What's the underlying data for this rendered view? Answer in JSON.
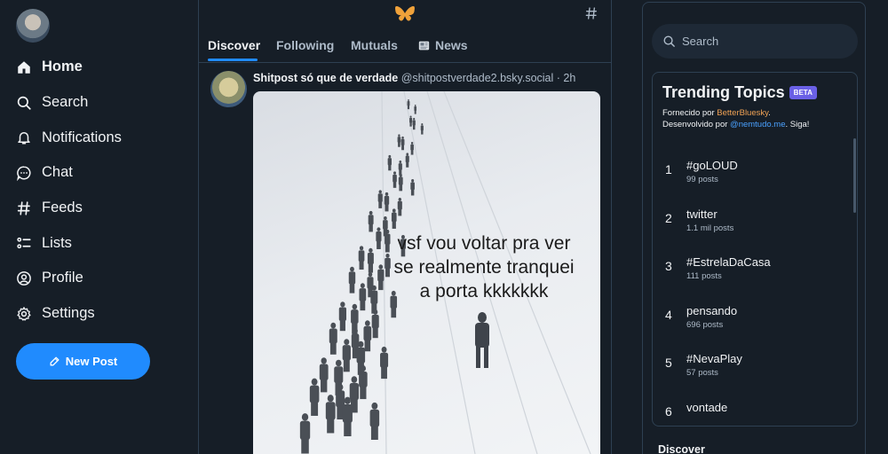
{
  "nav": {
    "items": [
      {
        "id": "home",
        "label": "Home"
      },
      {
        "id": "search",
        "label": "Search"
      },
      {
        "id": "notifications",
        "label": "Notifications"
      },
      {
        "id": "chat",
        "label": "Chat"
      },
      {
        "id": "feeds",
        "label": "Feeds"
      },
      {
        "id": "lists",
        "label": "Lists"
      },
      {
        "id": "profile",
        "label": "Profile"
      },
      {
        "id": "settings",
        "label": "Settings"
      }
    ],
    "active": "home",
    "new_post_label": "New Post"
  },
  "feed": {
    "tabs": [
      "Discover",
      "Following",
      "Mutuals",
      "News"
    ],
    "active_tab": "Discover",
    "post": {
      "author": "Shitpost só que de verdade",
      "handle": "@shitpostverdade2.bsky.social",
      "time": "· 2h",
      "image_text": [
        "vsf vou voltar pra ver",
        "se realmente tranquei",
        "a porta kkkkkkk"
      ]
    }
  },
  "sidebar": {
    "search_placeholder": "Search",
    "trending": {
      "title": "Trending Topics",
      "badge": "BETA",
      "provided_by_prefix": "Fornecido por ",
      "provided_by": "BetterBluesky",
      "provided_by_suffix": ".",
      "developed_by_prefix": "Desenvolvido por ",
      "developed_by": "@nemtudo.me",
      "developed_by_suffix": ". Siga!",
      "items": [
        {
          "rank": "1",
          "name": "#goLOUD",
          "count": "99 posts"
        },
        {
          "rank": "2",
          "name": "twitter",
          "count": "1.1 mil posts"
        },
        {
          "rank": "3",
          "name": "#EstrelaDaCasa",
          "count": "111 posts"
        },
        {
          "rank": "4",
          "name": "pensando",
          "count": "696 posts"
        },
        {
          "rank": "5",
          "name": "#NevaPlay",
          "count": "57 posts"
        },
        {
          "rank": "6",
          "name": "vontade",
          "count": ""
        }
      ]
    },
    "discover_label": "Discover"
  },
  "colors": {
    "background": "#161e27",
    "accent": "#208bfe",
    "border": "#2e4052",
    "muted_text": "#aebbc9",
    "beta": "#6a60e6"
  }
}
